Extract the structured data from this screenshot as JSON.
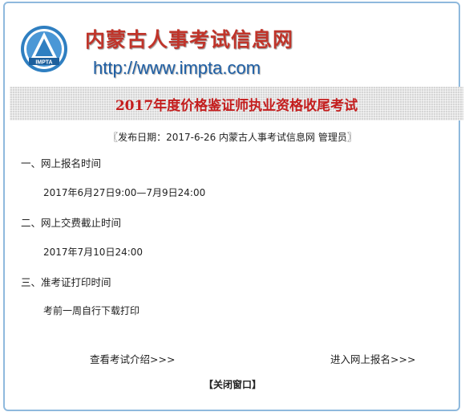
{
  "header": {
    "logo_text": "IMPTA",
    "site_name": "内蒙古人事考试信息网",
    "site_url": "http://www.impta.com"
  },
  "notice": {
    "title": "2017年度价格鉴证师执业资格收尾考试",
    "meta": "〖发布日期：2017-6-26 内蒙古人事考试信息网 管理员〗",
    "sections": [
      {
        "heading": "一、网上报名时间",
        "value": "2017年6月27日9:00—7月9日24:00"
      },
      {
        "heading": "二、网上交费截止时间",
        "value": "2017年7月10日24:00"
      },
      {
        "heading": "三、准考证打印时间",
        "value": "考前一周自行下载打印"
      }
    ]
  },
  "footer": {
    "exam_intro_link": "查看考试介绍>>>",
    "register_link": "进入网上报名>>>",
    "close_button": "【关闭窗口】"
  },
  "colors": {
    "title_red": "#c41d1d",
    "site_name_red": "#c0342a",
    "url_blue": "#1e5fa5",
    "frame_border": "#8fb9dd",
    "title_bar_bg": "#d6d6d6"
  }
}
